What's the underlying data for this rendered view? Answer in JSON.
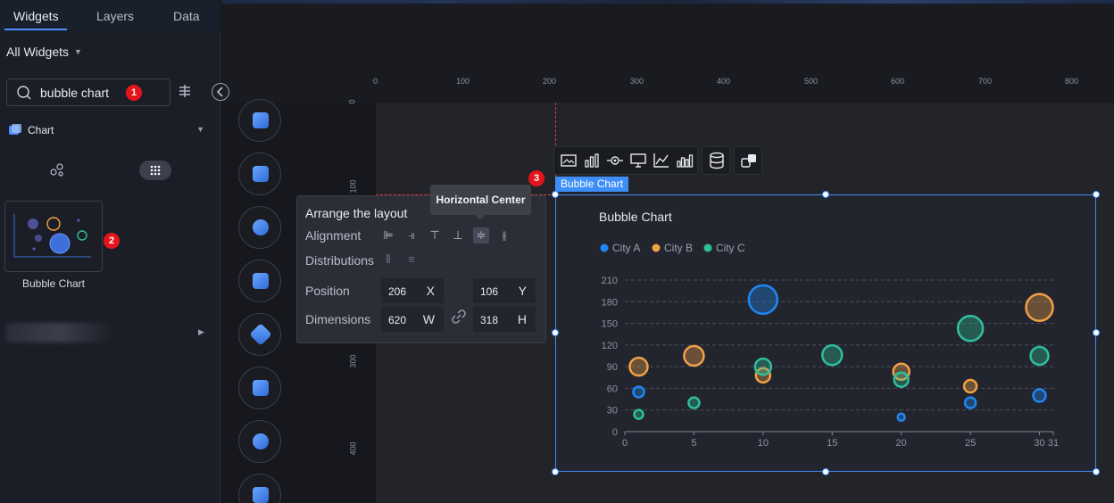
{
  "left_panel": {
    "tabs": [
      "Widgets",
      "Layers",
      "Data"
    ],
    "active_tab": "Widgets",
    "filter_label": "All Widgets",
    "search_value": "bubble chart",
    "category": "Chart",
    "widget_name": "Bubble Chart"
  },
  "badges": {
    "one": "1",
    "two": "2",
    "three": "3"
  },
  "rulers": {
    "h": [
      "0",
      "100",
      "200",
      "300",
      "400",
      "500",
      "600",
      "700",
      "800"
    ],
    "v": [
      "0",
      "100",
      "300",
      "400"
    ]
  },
  "arrange": {
    "title": "Arrange the layout",
    "alignment_label": "Alignment",
    "distributions_label": "Distributions",
    "position_label": "Position",
    "dimensions_label": "Dimensions",
    "x_value": "206",
    "x_unit": "X",
    "y_value": "106",
    "y_unit": "Y",
    "w_value": "620",
    "w_unit": "W",
    "h_value": "318",
    "h_unit": "H"
  },
  "tooltip": "Horizontal Center",
  "selection_label": "Bubble Chart",
  "colors": {
    "city_a": "#1f86f2",
    "city_b": "#f2a047",
    "city_c": "#2fbf9b",
    "selection": "#3e8ef7"
  },
  "chart_data": {
    "type": "scatter",
    "title": "Bubble Chart",
    "xlabel": "",
    "ylabel": "",
    "x_ticks": [
      "0",
      "5",
      "10",
      "15",
      "20",
      "25",
      "30",
      "31"
    ],
    "y_ticks": [
      "0",
      "30",
      "60",
      "90",
      "120",
      "150",
      "180",
      "210"
    ],
    "xlim": [
      0,
      31
    ],
    "ylim": [
      0,
      210
    ],
    "legend_position": "top-left",
    "series": [
      {
        "name": "City A",
        "color": "#1f86f2",
        "points": [
          {
            "x": 1,
            "y": 55,
            "size": 6
          },
          {
            "x": 10,
            "y": 183,
            "size": 16
          },
          {
            "x": 20,
            "y": 20,
            "size": 4
          },
          {
            "x": 25,
            "y": 40,
            "size": 6
          },
          {
            "x": 30,
            "y": 50,
            "size": 7
          }
        ]
      },
      {
        "name": "City B",
        "color": "#f2a047",
        "points": [
          {
            "x": 1,
            "y": 90,
            "size": 10
          },
          {
            "x": 5,
            "y": 105,
            "size": 11
          },
          {
            "x": 10,
            "y": 78,
            "size": 8
          },
          {
            "x": 20,
            "y": 83,
            "size": 9
          },
          {
            "x": 25,
            "y": 63,
            "size": 7
          },
          {
            "x": 30,
            "y": 172,
            "size": 15
          }
        ]
      },
      {
        "name": "City C",
        "color": "#2fbf9b",
        "points": [
          {
            "x": 1,
            "y": 24,
            "size": 5
          },
          {
            "x": 5,
            "y": 40,
            "size": 6
          },
          {
            "x": 10,
            "y": 90,
            "size": 9
          },
          {
            "x": 15,
            "y": 106,
            "size": 11
          },
          {
            "x": 20,
            "y": 72,
            "size": 8
          },
          {
            "x": 25,
            "y": 143,
            "size": 14
          },
          {
            "x": 30,
            "y": 105,
            "size": 10
          }
        ]
      }
    ]
  }
}
